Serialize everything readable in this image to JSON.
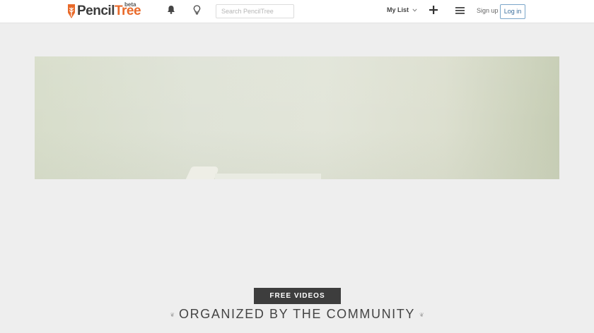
{
  "header": {
    "logo_part1": "Pencil",
    "logo_part2": "Tree",
    "beta_label": "beta",
    "search_placeholder": "Search PencilTree",
    "mylist_label": "My List",
    "signup_label": "Sign up",
    "login_label": "Log in",
    "icons": [
      "bell-icon",
      "lightbulb-icon",
      "chevron-down-icon",
      "plus-icon",
      "menu-icon"
    ]
  },
  "hero": {
    "free_videos_label": "FREE VIDEOS",
    "tagline": "ORGANIZED BY THE COMMUNITY"
  },
  "colors": {
    "brand_orange": "#e96a2a",
    "badge_dark": "#3d3d3d",
    "login_blue": "#3a6e9c"
  }
}
